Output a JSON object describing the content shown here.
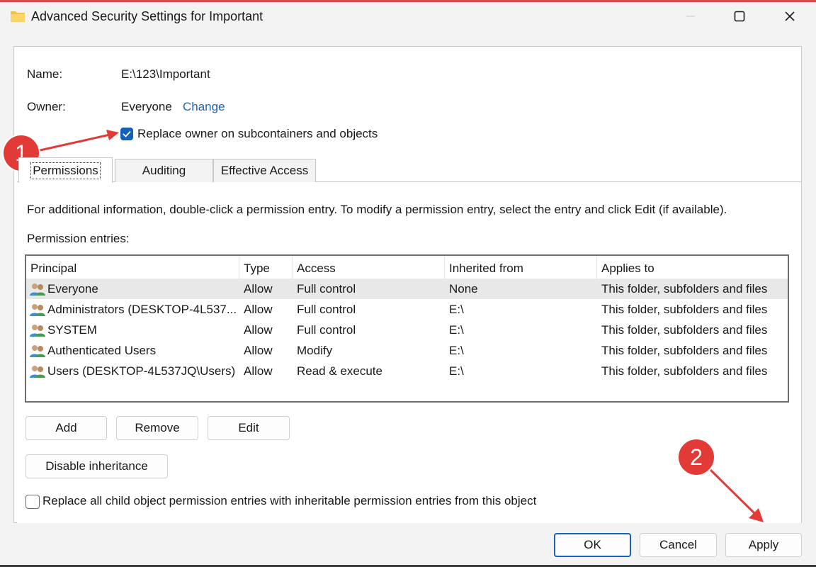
{
  "window": {
    "title": "Advanced Security Settings for Important"
  },
  "info": {
    "name_label": "Name:",
    "name_value": "E:\\123\\Important",
    "owner_label": "Owner:",
    "owner_value": "Everyone",
    "change_link": "Change",
    "replace_owner_label": "Replace owner on subcontainers and objects",
    "replace_owner_checked": true
  },
  "tabs": [
    {
      "label": "Permissions",
      "active": true
    },
    {
      "label": "Auditing",
      "active": false
    },
    {
      "label": "Effective Access",
      "active": false
    }
  ],
  "permissions": {
    "instructions": "For additional information, double-click a permission entry. To modify a permission entry, select the entry and click Edit (if available).",
    "entries_label": "Permission entries:",
    "columns": [
      "Principal",
      "Type",
      "Access",
      "Inherited from",
      "Applies to"
    ],
    "rows": [
      {
        "principal": "Everyone",
        "type": "Allow",
        "access": "Full control",
        "inherited": "None",
        "applies": "This folder, subfolders and files"
      },
      {
        "principal": "Administrators (DESKTOP-4L537...",
        "type": "Allow",
        "access": "Full control",
        "inherited": "E:\\",
        "applies": "This folder, subfolders and files"
      },
      {
        "principal": "SYSTEM",
        "type": "Allow",
        "access": "Full control",
        "inherited": "E:\\",
        "applies": "This folder, subfolders and files"
      },
      {
        "principal": "Authenticated Users",
        "type": "Allow",
        "access": "Modify",
        "inherited": "E:\\",
        "applies": "This folder, subfolders and files"
      },
      {
        "principal": "Users (DESKTOP-4L537JQ\\Users)",
        "type": "Allow",
        "access": "Read & execute",
        "inherited": "E:\\",
        "applies": "This folder, subfolders and files"
      }
    ],
    "add_label": "Add",
    "remove_label": "Remove",
    "edit_label": "Edit",
    "disable_inheritance_label": "Disable inheritance",
    "replace_child_label": "Replace all child object permission entries with inheritable permission entries from this object",
    "replace_child_checked": false
  },
  "footer": {
    "ok_label": "OK",
    "cancel_label": "Cancel",
    "apply_label": "Apply"
  },
  "annotations": {
    "badge_1": "1",
    "badge_2": "2",
    "color": "#e23a36"
  },
  "icons": {
    "window": "folder-icon",
    "minimize": "minimize-icon",
    "maximize": "maximize-icon",
    "close": "close-icon",
    "principal": "users-icon"
  }
}
